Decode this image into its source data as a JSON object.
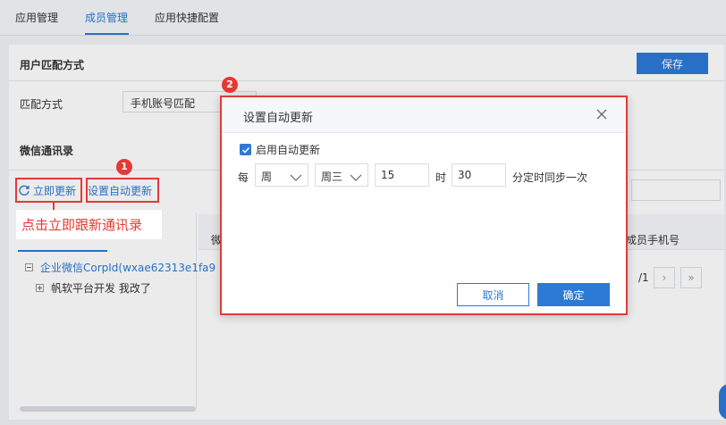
{
  "tabs": [
    "应用管理",
    "成员管理",
    "应用快捷配置"
  ],
  "section_user_match": "用户匹配方式",
  "save_label": "保存",
  "match_label": "匹配方式",
  "match_value": "手机账号匹配",
  "section_contacts": "微信通讯录",
  "refresh_label": "立即更新",
  "auto_update_label": "设置自动更新",
  "annotation_text": "点击立即跟新通讯录",
  "marker_1": "1",
  "marker_2": "2",
  "tree_root": "企业微信CorpId(wxae62313e1fa9",
  "tree_child": "帆软平台开发 我改了",
  "grid_col_left": "微",
  "grid_col_right": "成员手机号",
  "pager_text": "/1",
  "dialog": {
    "title": "设置自动更新",
    "enable_label": "启用自动更新",
    "enabled": true,
    "every_label": "每",
    "period_value": "周",
    "weekday_value": "周三",
    "hour_value": "15",
    "hour_label": "时",
    "minute_value": "30",
    "minute_label": "分定时同步一次",
    "cancel_label": "取消",
    "ok_label": "确定"
  },
  "colors": {
    "accent": "#2c7ad6",
    "annotation": "#e53935"
  },
  "icons": [
    "refresh-icon",
    "close-icon",
    "chevron-down-icon",
    "checkmark-icon",
    "expand-icon",
    "collapse-icon"
  ]
}
